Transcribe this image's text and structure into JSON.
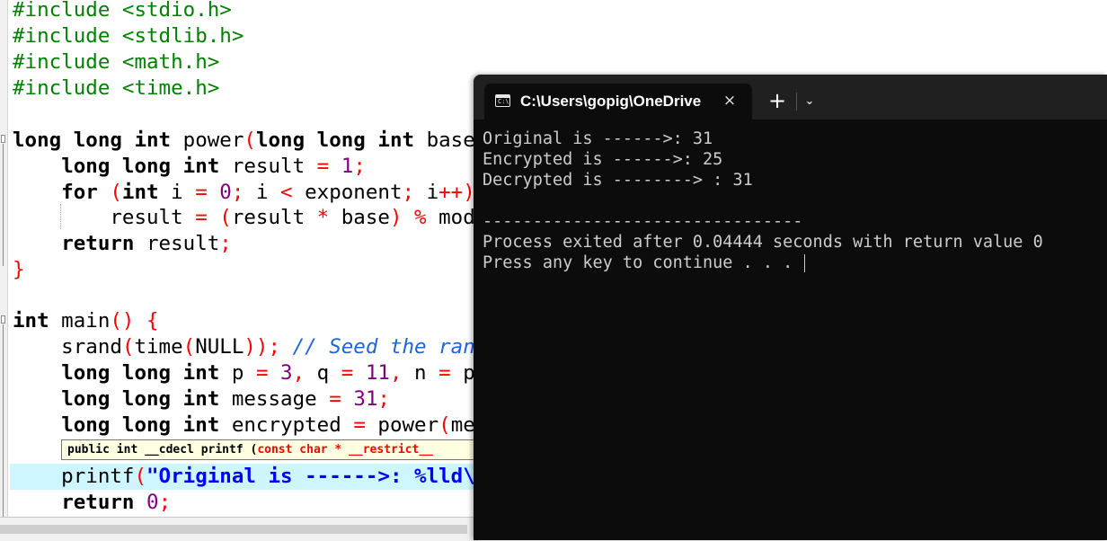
{
  "editor": {
    "tooltip": {
      "prefix": "public int __cdecl printf (",
      "param": "const char * __restrict__"
    }
  },
  "terminal": {
    "tab_title": "C:\\Users\\gopig\\OneDrive",
    "tab_icon_glyph": "C:\\",
    "close_glyph": "×",
    "new_tab_glyph": "+",
    "dropdown_glyph": "⌄",
    "output": [
      "Original is ------>: 31",
      "Encrypted is ------>: 25",
      "Decrypted is --------> : 31",
      "",
      "--------------------------------",
      "Process exited after 0.04444 seconds with return value 0",
      "Press any key to continue . . . "
    ]
  }
}
